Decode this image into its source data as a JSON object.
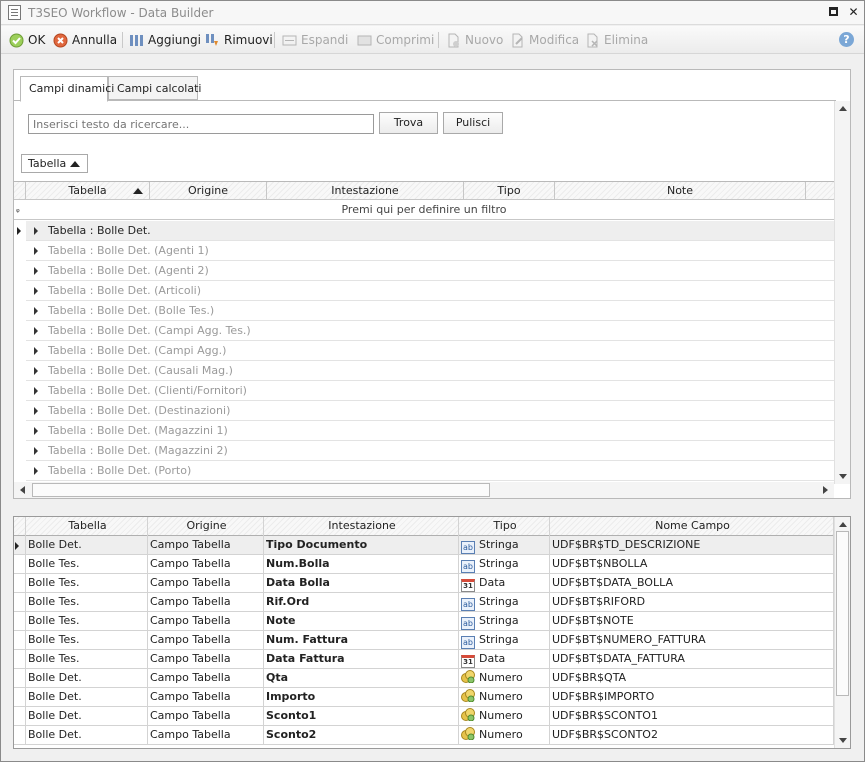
{
  "window": {
    "title": "T3SEO Workflow - Data Builder"
  },
  "toolbar": {
    "ok": "OK",
    "cancel": "Annulla",
    "add": "Aggiungi",
    "remove": "Rimuovi",
    "expand": "Espandi",
    "collapse": "Comprimi",
    "new": "Nuovo",
    "edit": "Modifica",
    "delete": "Elimina"
  },
  "tabs": [
    {
      "label": "Campi dinamici"
    },
    {
      "label": "Campi calcolati"
    }
  ],
  "search": {
    "placeholder": "Inserisci testo da ricercare...",
    "find": "Trova",
    "clear": "Pulisci"
  },
  "group_by": "Tabella",
  "upper_grid": {
    "columns": [
      "Tabella",
      "Origine",
      "Intestazione",
      "Tipo",
      "Note"
    ],
    "filter_hint": "Premi qui per definire un filtro",
    "groups": [
      "Tabella : Bolle Det.",
      "Tabella : Bolle Det. (Agenti 1)",
      "Tabella : Bolle Det. (Agenti 2)",
      "Tabella : Bolle Det. (Articoli)",
      "Tabella : Bolle Det. (Bolle Tes.)",
      "Tabella : Bolle Det. (Campi Agg. Tes.)",
      "Tabella : Bolle Det. (Campi Agg.)",
      "Tabella : Bolle Det. (Causali Mag.)",
      "Tabella : Bolle Det. (Clienti/Fornitori)",
      "Tabella : Bolle Det. (Destinazioni)",
      "Tabella : Bolle Det. (Magazzini 1)",
      "Tabella : Bolle Det. (Magazzini 2)",
      "Tabella : Bolle Det. (Porto)"
    ]
  },
  "lower_grid": {
    "columns": [
      "Tabella",
      "Origine",
      "Intestazione",
      "Tipo",
      "Nome Campo"
    ],
    "rows": [
      {
        "tabella": "Bolle Det.",
        "origine": "Campo Tabella",
        "intestazione": "Tipo Documento",
        "tipo": "Stringa",
        "tipo_icon": "ab",
        "nome": "UDF$BR$TD_DESCRIZIONE"
      },
      {
        "tabella": "Bolle Tes.",
        "origine": "Campo Tabella",
        "intestazione": "Num.Bolla",
        "tipo": "Stringa",
        "tipo_icon": "ab",
        "nome": "UDF$BT$NBOLLA"
      },
      {
        "tabella": "Bolle Tes.",
        "origine": "Campo Tabella",
        "intestazione": "Data Bolla",
        "tipo": "Data",
        "tipo_icon": "31",
        "nome": "UDF$BT$DATA_BOLLA"
      },
      {
        "tabella": "Bolle Tes.",
        "origine": "Campo Tabella",
        "intestazione": "Rif.Ord",
        "tipo": "Stringa",
        "tipo_icon": "ab",
        "nome": "UDF$BT$RIFORD"
      },
      {
        "tabella": "Bolle Tes.",
        "origine": "Campo Tabella",
        "intestazione": "Note",
        "tipo": "Stringa",
        "tipo_icon": "ab",
        "nome": "UDF$BT$NOTE"
      },
      {
        "tabella": "Bolle Tes.",
        "origine": "Campo Tabella",
        "intestazione": "Num. Fattura",
        "tipo": "Stringa",
        "tipo_icon": "ab",
        "nome": "UDF$BT$NUMERO_FATTURA"
      },
      {
        "tabella": "Bolle Tes.",
        "origine": "Campo Tabella",
        "intestazione": "Data Fattura",
        "tipo": "Data",
        "tipo_icon": "31",
        "nome": "UDF$BT$DATA_FATTURA"
      },
      {
        "tabella": "Bolle Det.",
        "origine": "Campo Tabella",
        "intestazione": "Qta",
        "tipo": "Numero",
        "tipo_icon": "coins",
        "nome": "UDF$BR$QTA"
      },
      {
        "tabella": "Bolle Det.",
        "origine": "Campo Tabella",
        "intestazione": "Importo",
        "tipo": "Numero",
        "tipo_icon": "coins",
        "nome": "UDF$BR$IMPORTO"
      },
      {
        "tabella": "Bolle Det.",
        "origine": "Campo Tabella",
        "intestazione": "Sconto1",
        "tipo": "Numero",
        "tipo_icon": "coins",
        "nome": "UDF$BR$SCONTO1"
      },
      {
        "tabella": "Bolle Det.",
        "origine": "Campo Tabella",
        "intestazione": "Sconto2",
        "tipo": "Numero",
        "tipo_icon": "coins",
        "nome": "UDF$BR$SCONTO2"
      }
    ]
  },
  "colors": {
    "accent": "#5a7fb3",
    "selected_row": "#eeeeee",
    "group_text": "#9a9a9a"
  }
}
